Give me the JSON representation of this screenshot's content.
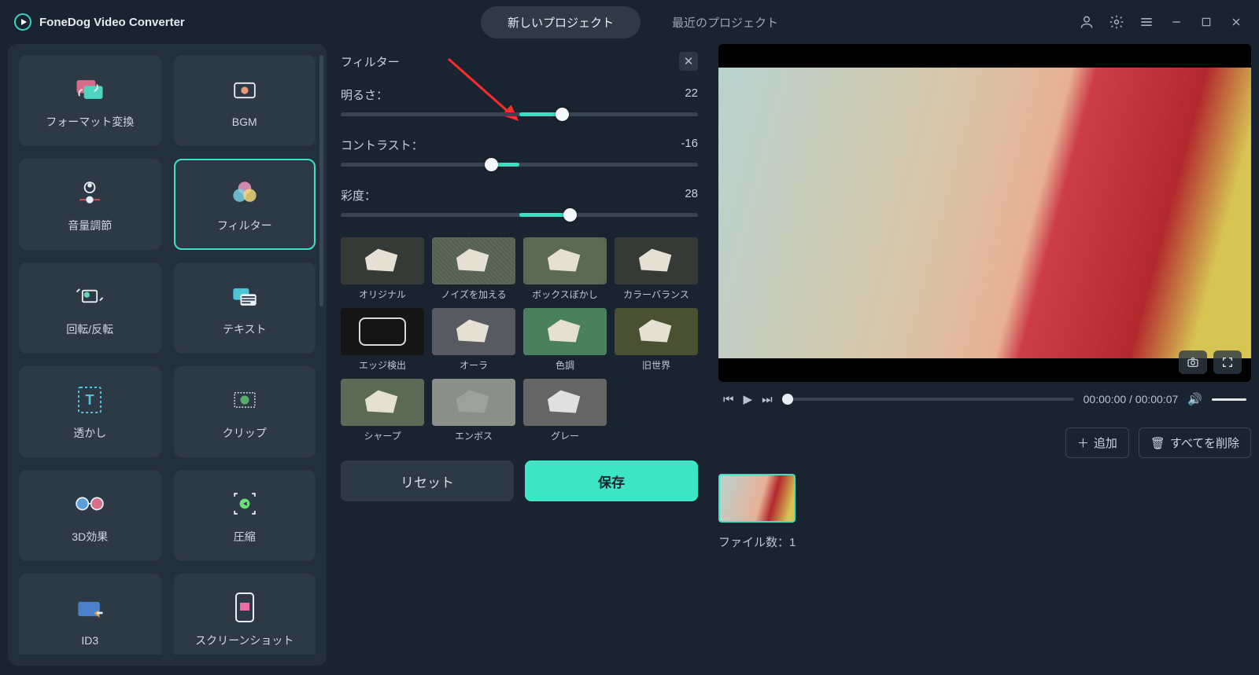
{
  "brand": "FoneDog Video Converter",
  "header": {
    "tab_new": "新しいプロジェクト",
    "tab_recent": "最近のプロジェクト"
  },
  "tools": [
    {
      "id": "format",
      "label": "フォーマット変換",
      "icon": "convert-icon"
    },
    {
      "id": "bgm",
      "label": "BGM",
      "icon": "bgm-icon"
    },
    {
      "id": "volume",
      "label": "音量調節",
      "icon": "volume-icon"
    },
    {
      "id": "filter",
      "label": "フィルター",
      "icon": "filter-icon",
      "active": true
    },
    {
      "id": "rotate",
      "label": "回転/反転",
      "icon": "rotate-icon"
    },
    {
      "id": "text",
      "label": "テキスト",
      "icon": "text-icon"
    },
    {
      "id": "watermark",
      "label": "透かし",
      "icon": "watermark-icon"
    },
    {
      "id": "clip",
      "label": "クリップ",
      "icon": "clip-icon"
    },
    {
      "id": "3d",
      "label": "3D効果",
      "icon": "3d-icon"
    },
    {
      "id": "compress",
      "label": "圧縮",
      "icon": "compress-icon"
    },
    {
      "id": "id3",
      "label": "ID3",
      "icon": "id3-icon"
    },
    {
      "id": "screenshot",
      "label": "スクリーンショット",
      "icon": "screenshot-icon"
    }
  ],
  "filter_panel": {
    "title": "フィルター",
    "brightness": {
      "label": "明るさ：",
      "value": 22,
      "fill_from": 50,
      "fill_to": 62,
      "thumb": 62
    },
    "contrast": {
      "label": "コントラスト：",
      "value": -16,
      "fill_from": 42,
      "fill_to": 50,
      "thumb": 42
    },
    "saturation": {
      "label": "彩度：",
      "value": 28,
      "fill_from": 50,
      "fill_to": 64,
      "thumb": 64
    },
    "presets": [
      {
        "label": "オリジナル",
        "cls": "v1"
      },
      {
        "label": "ノイズを加える",
        "cls": "noise"
      },
      {
        "label": "ボックスぼかし",
        "cls": "box"
      },
      {
        "label": "カラーバランス",
        "cls": "v1"
      },
      {
        "label": "エッジ検出",
        "cls": "edge"
      },
      {
        "label": "オーラ",
        "cls": "aura"
      },
      {
        "label": "色調",
        "cls": "tone"
      },
      {
        "label": "旧世界",
        "cls": "old"
      },
      {
        "label": "シャープ",
        "cls": "sharp"
      },
      {
        "label": "エンボス",
        "cls": "emboss"
      },
      {
        "label": "グレー",
        "cls": "grey"
      }
    ],
    "reset": "リセット",
    "save": "保存"
  },
  "preview": {
    "time": "00:00:00 / 00:00:07"
  },
  "actions": {
    "add": "追加",
    "delete_all": "すべてを削除"
  },
  "files": {
    "count_label": "ファイル数：1"
  }
}
